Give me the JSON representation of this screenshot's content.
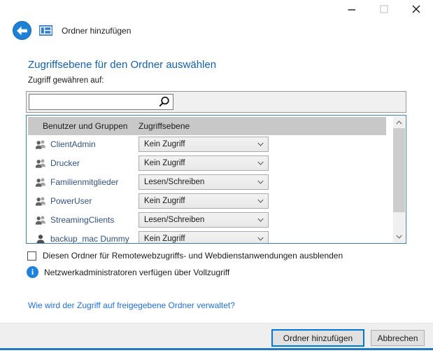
{
  "header": {
    "title": "Ordner hinzufügen",
    "controls": {
      "minimize": "minimize",
      "maximize": "maximize",
      "close": "close"
    }
  },
  "main": {
    "heading": "Zugriffsebene für den Ordner auswählen",
    "search_label": "Zugriff gewähren auf:",
    "search": {
      "value": ""
    },
    "table": {
      "columns": [
        "Benutzer und Gruppen",
        "Zugriffsebene"
      ],
      "rows": [
        {
          "name": "ClientAdmin",
          "icon": "group",
          "access": "Kein Zugriff"
        },
        {
          "name": "Drucker",
          "icon": "group",
          "access": "Kein Zugriff"
        },
        {
          "name": "Familienmitglieder",
          "icon": "group",
          "access": "Lesen/Schreiben"
        },
        {
          "name": "PowerUser",
          "icon": "group",
          "access": "Kein Zugriff"
        },
        {
          "name": "StreamingClients",
          "icon": "group",
          "access": "Lesen/Schreiben"
        },
        {
          "name": "backup_mac Dummy",
          "icon": "user",
          "access": "Kein Zugriff"
        }
      ]
    },
    "checkbox": {
      "label": "Diesen Ordner für Remotewebzugriffs- und Webdienstanwendungen ausblenden",
      "checked": false
    },
    "info_text": "Netzwerkadministratoren verfügen über Vollzugriff",
    "link": "Wie wird der Zugriff auf freigegebene Ordner verwaltet?"
  },
  "footer": {
    "primary_button": "Ordner hinzufügen",
    "secondary_button": "Abbrechen"
  },
  "colors": {
    "accent": "#0078D7",
    "heading": "#1062B5",
    "link": "#2170DF",
    "username": "#33527F",
    "back_button": "#1E81D5",
    "info": "#1E81DD",
    "table_border": "#3C7FB1",
    "header_bg": "#C8C8C8"
  }
}
